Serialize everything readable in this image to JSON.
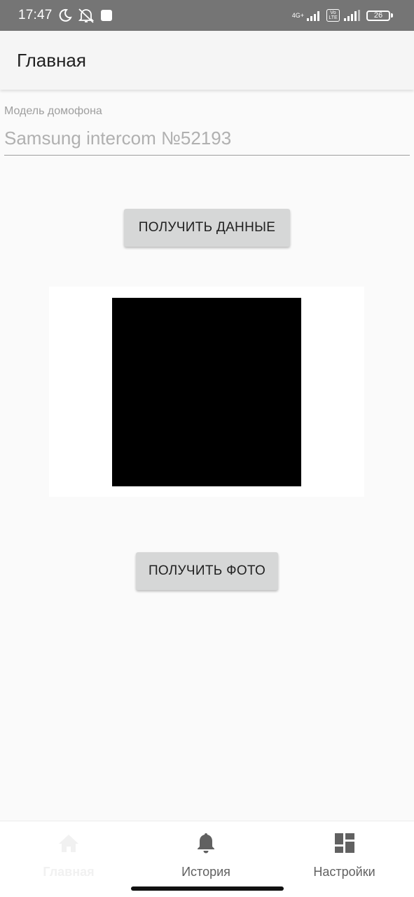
{
  "status_bar": {
    "time": "17:47",
    "network_label": "4G+",
    "volte_top": "Vo",
    "volte_bottom": "LTE",
    "battery": "26"
  },
  "app_bar": {
    "title": "Главная"
  },
  "intercom_field": {
    "label": "Модель домофона",
    "value": "",
    "placeholder": "Samsung intercom №52193"
  },
  "buttons": {
    "get_data": "ПОЛУЧИТЬ ДАННЫЕ",
    "get_photo": "ПОЛУЧИТЬ ФОТО"
  },
  "bottom_nav": {
    "items": [
      {
        "label": "Главная",
        "icon": "home-icon",
        "active": true
      },
      {
        "label": "История",
        "icon": "bell-icon",
        "active": false
      },
      {
        "label": "Настройки",
        "icon": "dashboard-icon",
        "active": false
      }
    ]
  },
  "colors": {
    "status_bar": "#757575",
    "app_bar": "#f5f5f5",
    "button": "#d6d7d7",
    "nav_inactive": "#616161",
    "nav_active": "#f1f1f1"
  }
}
